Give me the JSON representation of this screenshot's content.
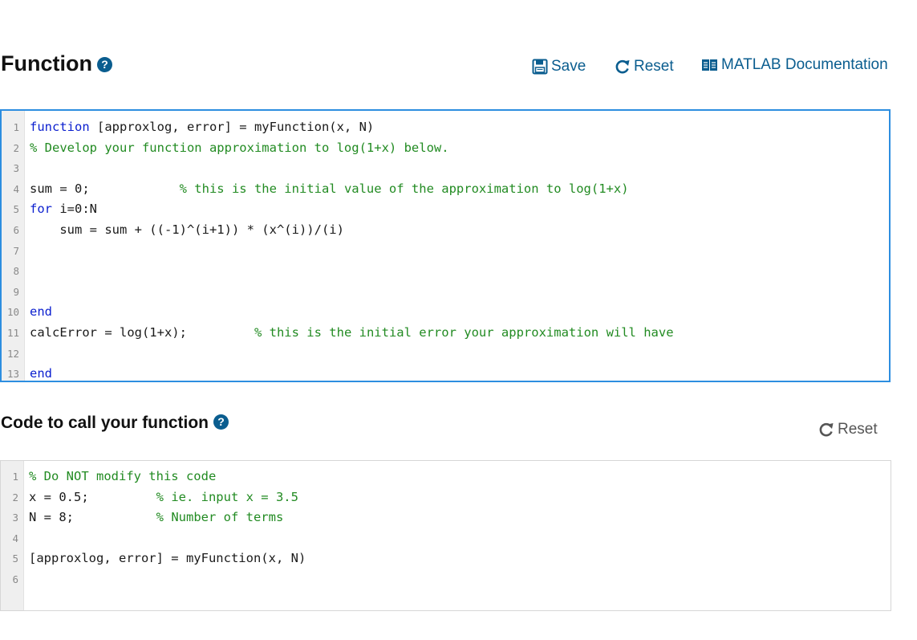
{
  "function_section": {
    "title": "Function",
    "help_icon": "question-circle-icon",
    "save_label": "Save",
    "reset_label": "Reset",
    "docs_label": "MATLAB Documentation"
  },
  "function_editor": {
    "lines": [
      {
        "n": "1",
        "segments": [
          {
            "t": "function",
            "c": "kw"
          },
          {
            "t": " [approxlog, error] = myFunction(x, N)",
            "c": ""
          }
        ]
      },
      {
        "n": "2",
        "segments": [
          {
            "t": "% Develop your function approximation to log(1+x) below.",
            "c": "cm"
          }
        ]
      },
      {
        "n": "3",
        "segments": []
      },
      {
        "n": "4",
        "segments": [
          {
            "t": "sum = 0;",
            "c": ""
          },
          {
            "t": "            ",
            "c": ""
          },
          {
            "t": "% this is the initial value of the approximation to log(1+x)",
            "c": "cm"
          }
        ]
      },
      {
        "n": "5",
        "segments": [
          {
            "t": "for",
            "c": "kw"
          },
          {
            "t": " i=0:N",
            "c": ""
          }
        ]
      },
      {
        "n": "6",
        "segments": [
          {
            "t": "    sum = sum + ((-1)^(i+1)) * (x^(i))/(i)",
            "c": ""
          }
        ]
      },
      {
        "n": "7",
        "segments": []
      },
      {
        "n": "8",
        "segments": []
      },
      {
        "n": "9",
        "segments": []
      },
      {
        "n": "10",
        "segments": [
          {
            "t": "end",
            "c": "kw"
          }
        ]
      },
      {
        "n": "11",
        "segments": [
          {
            "t": "calcError = log(1+x);",
            "c": ""
          },
          {
            "t": "         ",
            "c": ""
          },
          {
            "t": "% this is the initial error your approximation will have",
            "c": "cm"
          }
        ]
      },
      {
        "n": "12",
        "segments": []
      },
      {
        "n": "13",
        "segments": [
          {
            "t": "end",
            "c": "kw"
          }
        ]
      }
    ]
  },
  "call_section": {
    "title": "Code to call your function",
    "help_icon": "question-circle-icon",
    "reset_label": "Reset"
  },
  "call_editor": {
    "lines": [
      {
        "n": "1",
        "segments": [
          {
            "t": "% Do NOT modify this code",
            "c": "cm"
          }
        ]
      },
      {
        "n": "2",
        "segments": [
          {
            "t": "x = 0.5;",
            "c": ""
          },
          {
            "t": "         ",
            "c": ""
          },
          {
            "t": "% ie. input x = 3.5",
            "c": "cm"
          }
        ]
      },
      {
        "n": "3",
        "segments": [
          {
            "t": "N = 8;",
            "c": ""
          },
          {
            "t": "           ",
            "c": ""
          },
          {
            "t": "% Number of terms",
            "c": "cm"
          }
        ]
      },
      {
        "n": "4",
        "segments": []
      },
      {
        "n": "5",
        "segments": [
          {
            "t": "[approxlog, error] = myFunction(x, N)",
            "c": ""
          }
        ]
      },
      {
        "n": "6",
        "segments": []
      }
    ]
  },
  "colors": {
    "accent": "#0a5d8f",
    "focus_border": "#2d8ee0",
    "keyword": "#0b1fcf",
    "comment": "#228b22"
  }
}
